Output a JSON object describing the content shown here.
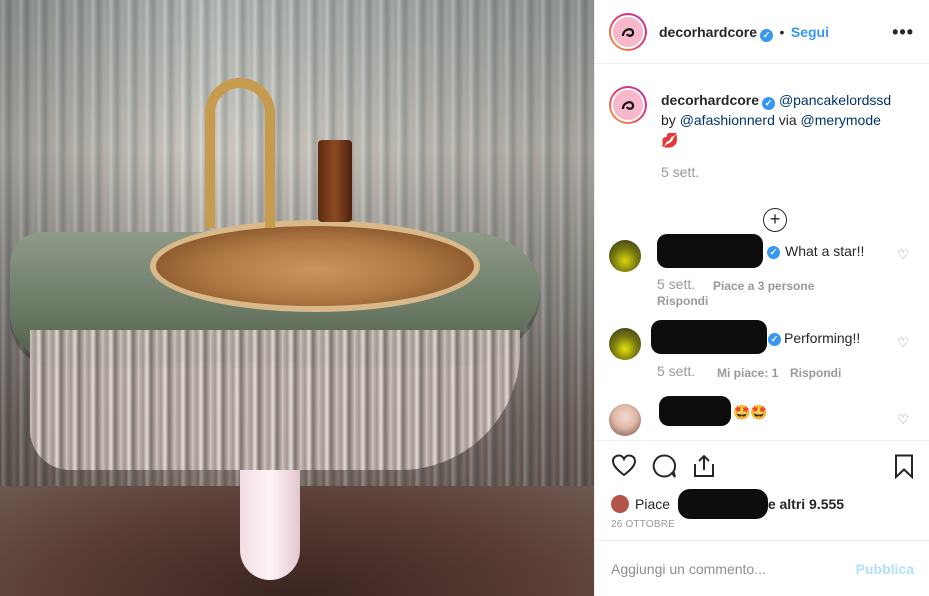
{
  "post": {
    "username": "decorhardcore",
    "follow_label": "Segui",
    "more_label": "•••"
  },
  "caption": {
    "username": "decorhardcore",
    "mention1": "@pancakelordssd",
    "by_word": "by",
    "mention2": "@afashionnerd",
    "via_word": "via",
    "mention3": "@merymode",
    "emoji": "💋",
    "time": "5 sett."
  },
  "comments": [
    {
      "text": "What a star!!",
      "time": "5 sett.",
      "likes": "Piace a 3 persone",
      "reply": "Rispondi"
    },
    {
      "text": "Performing!!",
      "time": "5 sett.",
      "likes": "Mi piace: 1",
      "reply": "Rispondi"
    },
    {
      "text": "🤩🤩"
    }
  ],
  "likes": {
    "prefix": "Piace",
    "suffix": "e altri 9.555"
  },
  "date": "26 OTTOBRE",
  "add_comment": {
    "placeholder": "Aggiungi un commento...",
    "publish_label": "Pubblica"
  },
  "colors": {
    "link_blue": "#3897f0",
    "mention_blue": "#003569",
    "muted": "#999999",
    "publish_disabled": "#b2dffc"
  }
}
